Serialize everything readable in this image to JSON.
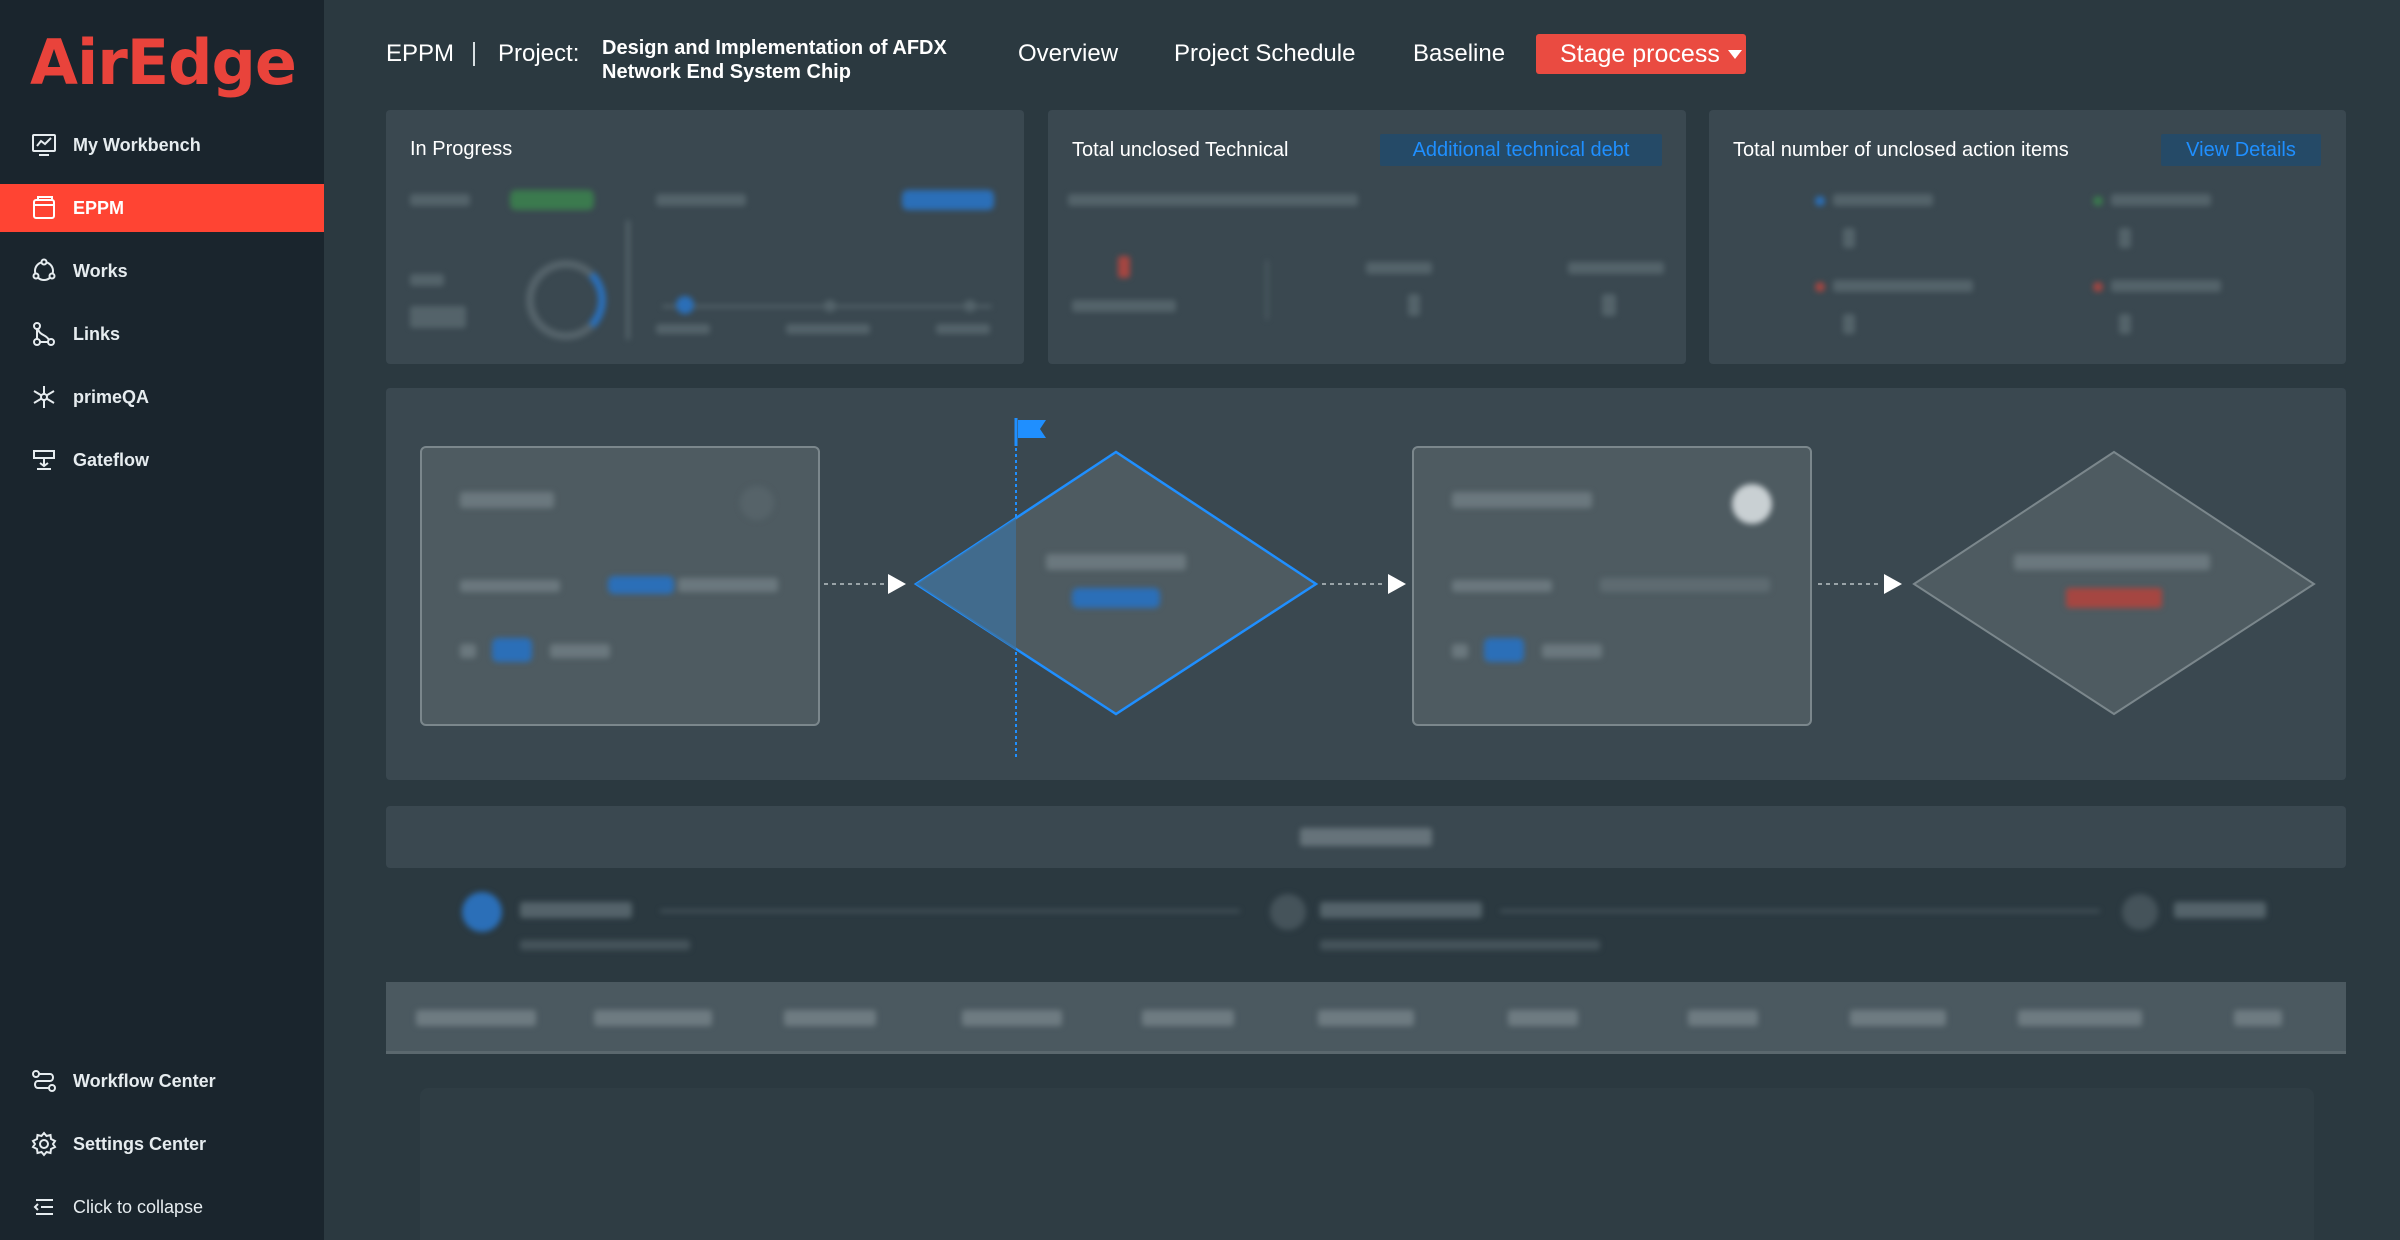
{
  "brand": {
    "logo_text": "AirEdge",
    "color": "#e9433b"
  },
  "sidebar": {
    "items": [
      {
        "label": "My Workbench",
        "icon": "monitor-chart-icon"
      },
      {
        "label": "EPPM",
        "icon": "window-icon",
        "active": true
      },
      {
        "label": "Works",
        "icon": "network-circle-icon"
      },
      {
        "label": "Links",
        "icon": "links-icon"
      },
      {
        "label": "primeQA",
        "icon": "asterisk-nodes-icon"
      },
      {
        "label": "Gateflow",
        "icon": "gate-icon"
      }
    ],
    "bottom_items": [
      {
        "label": "Workflow Center",
        "icon": "workflow-icon"
      },
      {
        "label": "Settings Center",
        "icon": "gear-icon"
      }
    ],
    "collapse_label": "Click to collapse",
    "active_color": "#ff4433"
  },
  "header": {
    "module": "EPPM",
    "project_label": "Project:",
    "project_title": "Design and Implementation of AFDX Network End System Chip",
    "tabs": [
      "Overview",
      "Project Schedule",
      "Baseline"
    ],
    "stage_button": "Stage process"
  },
  "cards": {
    "progress": {
      "title": "In Progress"
    },
    "technical": {
      "title": "Total unclosed Technical",
      "link": "Additional technical debt"
    },
    "actions": {
      "title": "Total number of unclosed action items",
      "link": "View Details"
    }
  },
  "colors": {
    "background": "#2b3940",
    "panel": "#3a4850",
    "link": "#1f8fff",
    "flow_accent": "#1f8fff"
  }
}
